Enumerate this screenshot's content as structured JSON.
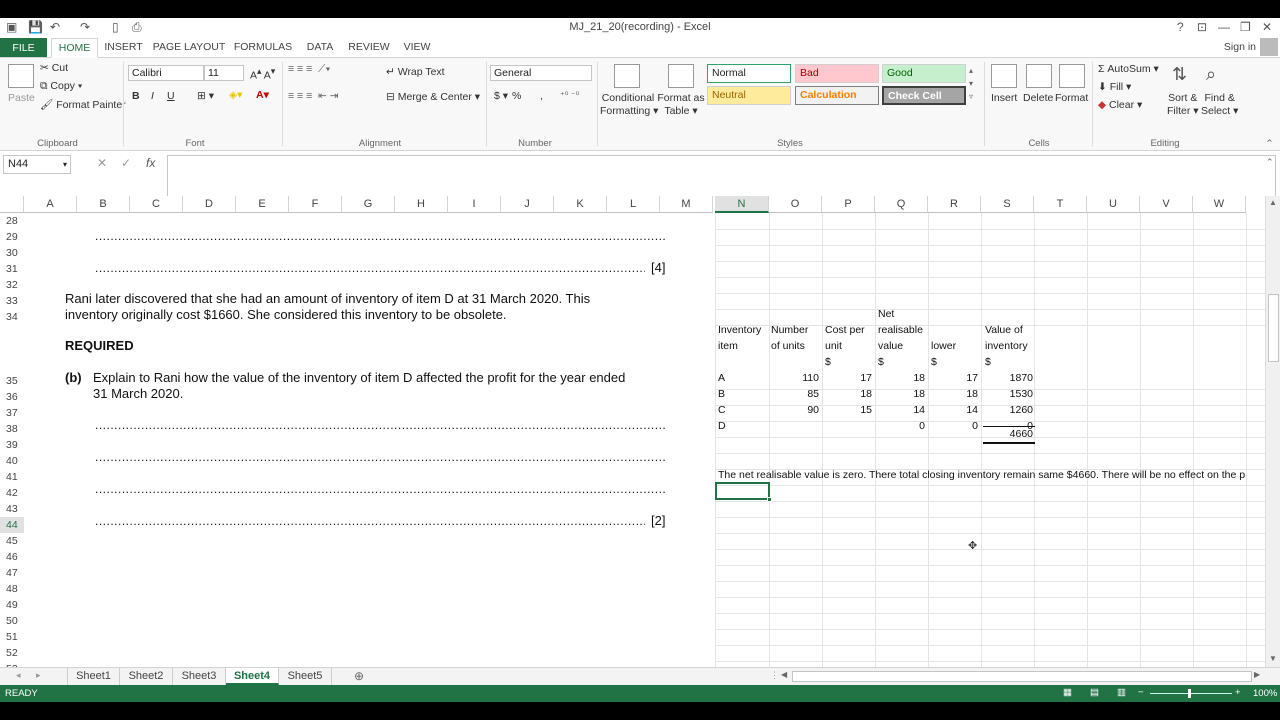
{
  "title": "MJ_21_20(recording) - Excel",
  "window": {
    "help": "?",
    "restore": "⧉",
    "maximize": "🗗",
    "close": "✕"
  },
  "tabs": [
    "FILE",
    "HOME",
    "INSERT",
    "PAGE LAYOUT",
    "FORMULAS",
    "DATA",
    "REVIEW",
    "VIEW"
  ],
  "sign_in": "Sign in",
  "ribbon": {
    "clipboard": {
      "paste": "Paste",
      "cut": "Cut",
      "copy": "Copy",
      "format_painter": "Format Painter",
      "label": "Clipboard"
    },
    "font": {
      "name": "Calibri",
      "size": "11",
      "label": "Font",
      "bold": "B",
      "italic": "I",
      "underline": "U"
    },
    "alignment": {
      "wrap": "Wrap Text",
      "merge": "Merge & Center",
      "label": "Alignment"
    },
    "number": {
      "format": "General",
      "label": "Number",
      "currency": "$",
      "percent": "%",
      "comma": ","
    },
    "styles": {
      "conditional": "Conditional",
      "conditional2": "Formatting",
      "format_as": "Format as",
      "format_as2": "Table",
      "normal": "Normal",
      "bad": "Bad",
      "good": "Good",
      "neutral": "Neutral",
      "calculation": "Calculation",
      "check_cell": "Check Cell",
      "label": "Styles"
    },
    "cells": {
      "insert": "Insert",
      "delete": "Delete",
      "format": "Format",
      "label": "Cells"
    },
    "editing": {
      "autosum": "AutoSum",
      "fill": "Fill",
      "clear": "Clear",
      "sort": "Sort &",
      "filter": "Filter",
      "find": "Find &",
      "select": "Select",
      "label": "Editing"
    }
  },
  "name_box": "N44",
  "fx": "fx",
  "columns": [
    "A",
    "B",
    "C",
    "D",
    "E",
    "F",
    "G",
    "H",
    "I",
    "J",
    "K",
    "L",
    "M",
    "N",
    "O",
    "P",
    "Q",
    "R",
    "S",
    "T",
    "U",
    "V",
    "W"
  ],
  "rows": [
    "28",
    "29",
    "30",
    "31",
    "32",
    "33",
    "34",
    "35",
    "36",
    "37",
    "38",
    "39",
    "40",
    "41",
    "42",
    "43",
    "44",
    "45",
    "46",
    "47",
    "48",
    "49",
    "50",
    "51",
    "52",
    "53"
  ],
  "document": {
    "mark4": "[4]",
    "para1": "Rani later discovered that she had an amount of inventory of item D at 31 March 2020. This",
    "para2": "inventory originally cost $1660. She considered this inventory to be obsolete.",
    "required": "REQUIRED",
    "b": "(b)",
    "q1": "Explain to Rani how the value of the inventory of item D affected the profit for the year ended",
    "q2": "31 March 2020.",
    "mark2": "[2]"
  },
  "table": {
    "headers": {
      "item": [
        "Inventory",
        "item"
      ],
      "units": [
        "Number",
        "of units"
      ],
      "cost": [
        "Cost per",
        "unit"
      ],
      "nrv": [
        "Net",
        "realisable",
        "value"
      ],
      "lower": "lower",
      "value": [
        "Value of",
        "inventory"
      ]
    },
    "currency": "$",
    "rows": [
      {
        "item": "A",
        "units": "110",
        "cost": "17",
        "nrv": "18",
        "lower": "17",
        "value": "1870"
      },
      {
        "item": "B",
        "units": "85",
        "cost": "18",
        "nrv": "18",
        "lower": "18",
        "value": "1530"
      },
      {
        "item": "C",
        "units": "90",
        "cost": "15",
        "nrv": "14",
        "lower": "14",
        "value": "1260"
      },
      {
        "item": "D",
        "units": "",
        "cost": "",
        "nrv": "0",
        "lower": "0",
        "value": "0"
      }
    ],
    "total": "4660",
    "note": "The net realisable value is zero. There total closing inventory remain same $4660. There will be no effect on the p"
  },
  "sheets": [
    "Sheet1",
    "Sheet2",
    "Sheet3",
    "Sheet4",
    "Sheet5"
  ],
  "active_sheet": "Sheet4",
  "status": {
    "ready": "READY",
    "zoom": "100%"
  }
}
